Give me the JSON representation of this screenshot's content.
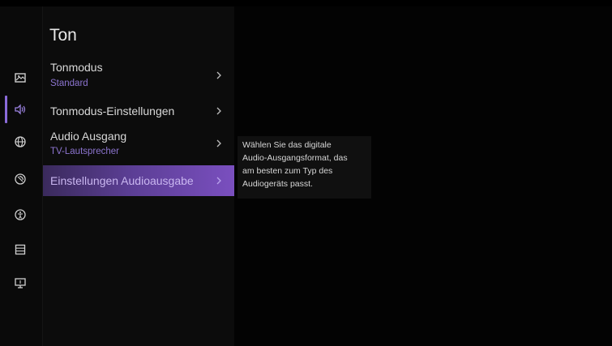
{
  "page": {
    "title": "Ton"
  },
  "rail": {
    "icons": [
      "picture-icon",
      "sound-icon",
      "network-icon",
      "remote-icon",
      "accessibility-icon",
      "list-icon",
      "display-icon"
    ],
    "active_index": 1,
    "accent": "#8a6bd9"
  },
  "menu": {
    "items": [
      {
        "label": "Tonmodus",
        "sub": "Standard"
      },
      {
        "label": "Tonmodus-Einstellungen",
        "sub": ""
      },
      {
        "label": "Audio Ausgang",
        "sub": "TV-Lautsprecher"
      },
      {
        "label": "Einstellungen Audioausgabe",
        "sub": ""
      }
    ],
    "selected_index": 3,
    "chevron": "›"
  },
  "info": {
    "lines": [
      "Wählen Sie das digitale",
      "Audio-Ausgangsformat, das",
      "am besten zum Typ des",
      "Audiogeräts passt."
    ]
  },
  "colors": {
    "accent": "#7a4fbf",
    "subtitle": "#8c74cf"
  }
}
